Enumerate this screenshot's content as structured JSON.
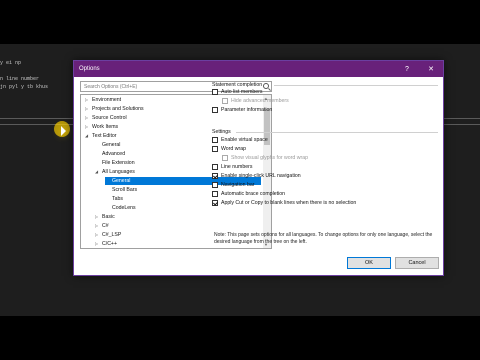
{
  "editor": {
    "lines": [
      "y ei np",
      "n line number",
      "jn pyl y tb khus"
    ]
  },
  "dialog": {
    "title": "Options",
    "help_glyph": "?",
    "close_glyph": "✕",
    "search_placeholder": "Search Options (Ctrl+E)",
    "tree": [
      {
        "label": "Environment",
        "arrow": "▷"
      },
      {
        "label": "Projects and Solutions",
        "arrow": "▷"
      },
      {
        "label": "Source Control",
        "arrow": "▷"
      },
      {
        "label": "Work Items",
        "arrow": "▷"
      },
      {
        "label": "Text Editor",
        "arrow": "◢"
      },
      {
        "label": "General",
        "arrow": ""
      },
      {
        "label": "Advanced",
        "arrow": ""
      },
      {
        "label": "File Extension",
        "arrow": ""
      },
      {
        "label": "All Languages",
        "arrow": "◢"
      },
      {
        "label": "General",
        "arrow": "",
        "selected": true
      },
      {
        "label": "Scroll Bars",
        "arrow": ""
      },
      {
        "label": "Tabs",
        "arrow": ""
      },
      {
        "label": "CodeLens",
        "arrow": ""
      },
      {
        "label": "Basic",
        "arrow": "▷"
      },
      {
        "label": "C#",
        "arrow": "▷"
      },
      {
        "label": "C#_LSP",
        "arrow": "▷"
      },
      {
        "label": "C/C++",
        "arrow": "▷"
      }
    ],
    "statement_completion": {
      "heading": "Statement completion",
      "options": [
        {
          "label": "Auto list members",
          "checked": false,
          "disabled": false
        },
        {
          "label": "Hide advanced members",
          "checked": false,
          "disabled": true
        },
        {
          "label": "Parameter information",
          "checked": false,
          "disabled": false
        }
      ]
    },
    "settings": {
      "heading": "Settings",
      "options": [
        {
          "label": "Enable virtual space",
          "checked": false,
          "disabled": false
        },
        {
          "label": "Word wrap",
          "checked": false,
          "disabled": false
        },
        {
          "label": "Show visual glyphs for word wrap",
          "checked": false,
          "disabled": true
        },
        {
          "label": "Line numbers",
          "checked": false,
          "disabled": false
        },
        {
          "label": "Enable single-click URL navigation",
          "checked": true,
          "disabled": false
        },
        {
          "label": "Navigation bar",
          "checked": false,
          "disabled": false
        },
        {
          "label": "Automatic brace completion",
          "checked": false,
          "disabled": false
        },
        {
          "label": "Apply Cut or Copy to blank lines when there is no selection",
          "checked": true,
          "disabled": false
        }
      ]
    },
    "note": "Note: This page sets options for all languages. To change options for only one language, select the desired language from the tree on the left.",
    "ok_label": "OK",
    "cancel_label": "Cancel"
  }
}
